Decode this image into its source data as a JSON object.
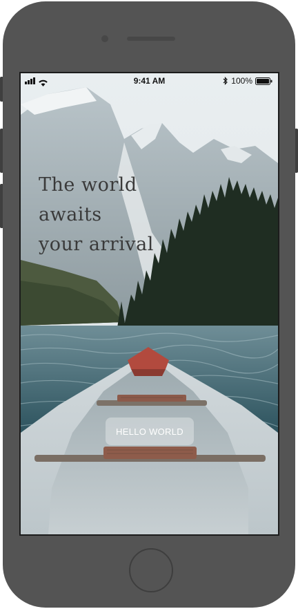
{
  "status_bar": {
    "time": "9:41 AM",
    "battery": "100%"
  },
  "hero": {
    "headline": "The world\nawaits\nyour arrival"
  },
  "cta": {
    "label": "HELLO WORLD"
  },
  "colors": {
    "device": "#545454",
    "button_bg": "rgba(255,255,255,0.33)",
    "headline": "#3a3a3a"
  }
}
